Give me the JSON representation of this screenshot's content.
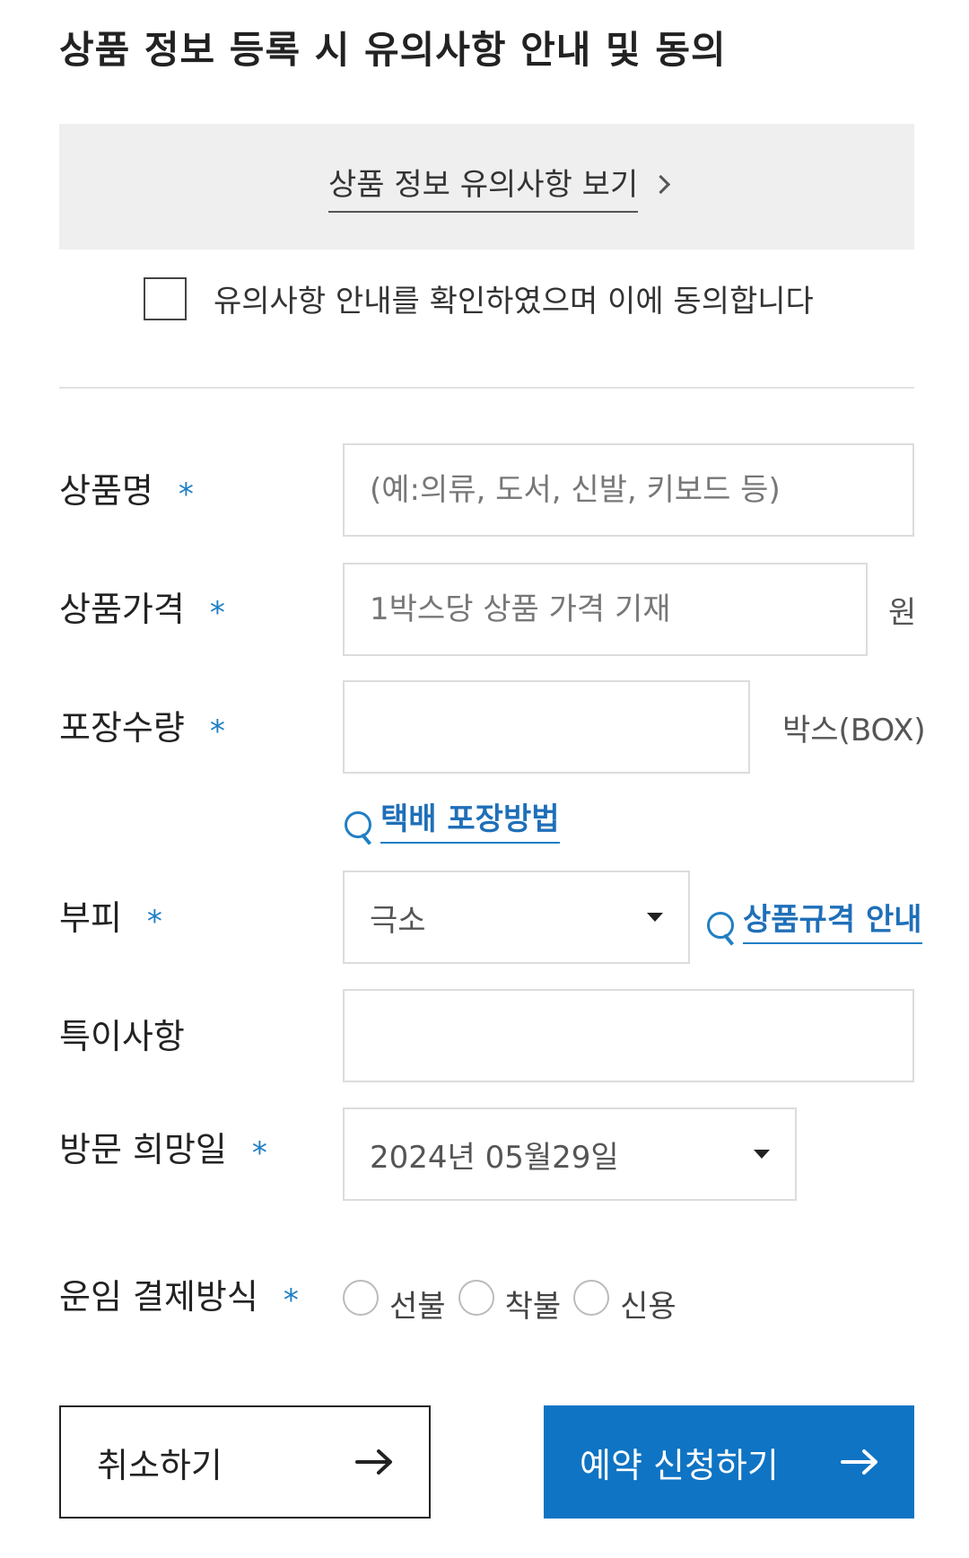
{
  "page_title": "상품 정보 등록 시 유의사항 안내 및 동의",
  "notice": {
    "link_label": "상품 정보 유의사항 보기"
  },
  "agreement": {
    "label": "유의사항 안내를 확인하였으며 이에 동의합니다",
    "checked": false
  },
  "required_mark": "*",
  "form": {
    "product_name": {
      "label": "상품명",
      "placeholder": "(예:의류, 도서, 신발, 키보드 등)",
      "value": ""
    },
    "product_price": {
      "label": "상품가격",
      "placeholder": "1박스당 상품 가격 기재",
      "value": "",
      "unit": "원"
    },
    "package_qty": {
      "label": "포장수량",
      "value": "",
      "unit": "박스(BOX)",
      "guide_link": "택배 포장방법"
    },
    "volume": {
      "label": "부피",
      "selected": "극소",
      "guide_link": "상품규격 안내"
    },
    "notes": {
      "label": "특이사항",
      "value": ""
    },
    "visit_date": {
      "label": "방문 희망일",
      "selected": "2024년 05월29일"
    },
    "payment": {
      "label": "운임 결제방식",
      "options": [
        "선불",
        "착불",
        "신용"
      ],
      "selected": null
    }
  },
  "buttons": {
    "cancel": "취소하기",
    "submit": "예약 신청하기"
  },
  "colors": {
    "accent": "#0f74c4",
    "link": "#1f6fb8",
    "notice_bg": "#efefef"
  },
  "icons": {
    "notice_link": "chevron-right-icon",
    "guide_link": "magnifier-icon",
    "select": "caret-down-icon",
    "button": "arrow-right-icon"
  }
}
